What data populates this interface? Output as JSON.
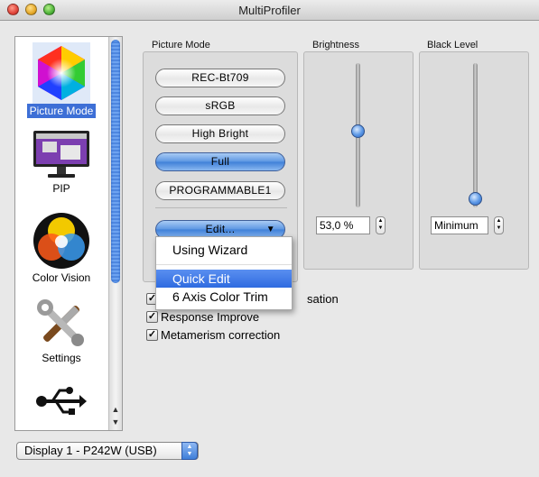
{
  "window": {
    "title": "MultiProfiler"
  },
  "sidebar": {
    "items": [
      {
        "label": "Picture Mode",
        "icon": "color-hexagon-icon",
        "selected": true
      },
      {
        "label": "PIP",
        "icon": "monitor-icon",
        "selected": false
      },
      {
        "label": "Color Vision",
        "icon": "rgb-circles-icon",
        "selected": false
      },
      {
        "label": "Settings",
        "icon": "tools-icon",
        "selected": false
      },
      {
        "label": "",
        "icon": "usb-icon",
        "selected": false
      }
    ]
  },
  "picture_mode": {
    "label": "Picture Mode",
    "buttons": [
      {
        "label": "REC-Bt709",
        "selected": false
      },
      {
        "label": "sRGB",
        "selected": false
      },
      {
        "label": "High Bright",
        "selected": false
      },
      {
        "label": "Full",
        "selected": true
      },
      {
        "label": "PROGRAMMABLE1",
        "selected": false
      }
    ],
    "edit_label": "Edit..."
  },
  "brightness": {
    "label": "Brightness",
    "value": "53,0 %",
    "level": 0.53
  },
  "black_level": {
    "label": "Black Level",
    "value": "Minimum",
    "level": 0.0
  },
  "edit_menu": {
    "items": [
      {
        "label": "Using Wizard",
        "highlighted": false
      },
      {
        "label": "Quick Edit",
        "highlighted": true
      },
      {
        "label": "6 Axis Color Trim",
        "highlighted": false
      }
    ]
  },
  "checkboxes": [
    {
      "label": "sation",
      "checked": true
    },
    {
      "label": "Response Improve",
      "checked": true
    },
    {
      "label": "Metamerism correction",
      "checked": true
    }
  ],
  "display_select": {
    "value": "Display 1 - P242W (USB)"
  },
  "colors": {
    "accent": "#3d6fd6",
    "selection": "#2f6be0"
  }
}
